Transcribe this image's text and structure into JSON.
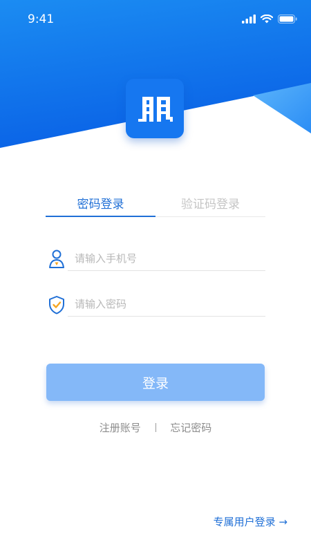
{
  "status_bar": {
    "time": "9:41",
    "icons": [
      "signal-icon",
      "wifi-icon",
      "battery-icon"
    ]
  },
  "theme": {
    "primary": "#1f6fd6",
    "hero_gradient_top": "#1b8cf2",
    "hero_gradient_bottom": "#0a62e6",
    "button_color": "#84b8f8"
  },
  "tabs": {
    "active_label": "密码登录",
    "inactive_label": "验证码登录"
  },
  "fields": {
    "phone_placeholder": "请输入手机号",
    "password_placeholder": "请输入密码"
  },
  "login_button_label": "登录",
  "links": {
    "register": "注册账号",
    "forgot": "忘记密码"
  },
  "exclusive_login": "专属用户登录 →"
}
